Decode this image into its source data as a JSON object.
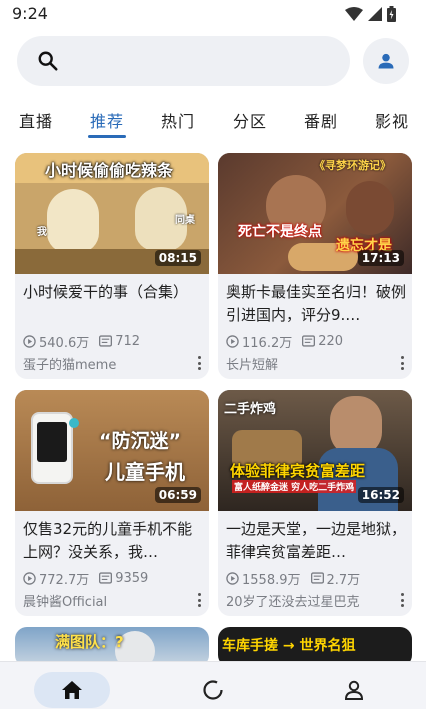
{
  "status_bar": {
    "time": "9:24"
  },
  "search": {
    "placeholder": ""
  },
  "tabs": [
    {
      "label": "直播",
      "active": false
    },
    {
      "label": "推荐",
      "active": true
    },
    {
      "label": "热门",
      "active": false
    },
    {
      "label": "分区",
      "active": false
    },
    {
      "label": "番剧",
      "active": false
    },
    {
      "label": "影视",
      "active": false
    }
  ],
  "videos": [
    {
      "thumb_text": "小时候偷偷吃辣条",
      "thumb_text_2": "我",
      "thumb_text_3": "同桌",
      "duration": "08:15",
      "title": "小时候爱干的事（合集）",
      "views": "540.6万",
      "danmaku": "712",
      "author": "蛋子的猫meme"
    },
    {
      "thumb_text": "《寻梦环游记》",
      "thumb_text_2": "死亡不是终点",
      "thumb_text_3": "遗忘才是",
      "duration": "17:13",
      "title": "奥斯卡最佳实至名归！破例引进国内，评分9.…",
      "views": "116.2万",
      "danmaku": "220",
      "author": "长片短解"
    },
    {
      "thumb_text": "“防沉迷”",
      "thumb_text_2": "儿童手机",
      "duration": "06:59",
      "title": "仅售32元的儿童手机不能上网？没关系，我…",
      "views": "772.7万",
      "danmaku": "9359",
      "author": "晨钟酱Official"
    },
    {
      "thumb_text": "二手炸鸡",
      "thumb_text_2": "体验菲律宾贫富差距",
      "thumb_text_3": "富人纸醉金迷 穷人吃二手炸鸡",
      "duration": "16:52",
      "title": "一边是天堂，一边是地狱，菲律宾贫富差距…",
      "views": "1558.9万",
      "danmaku": "2.7万",
      "author": "20岁了还没去过星巴克"
    },
    {
      "thumb_text": "满图队：?"
    },
    {
      "thumb_text": "车库手搓 → 世界名狙"
    }
  ],
  "colors": {
    "accent": "#2a6bb8",
    "card_bg": "#f0f1f5",
    "nav_active_bg": "#dce6f4"
  },
  "icons": {
    "search": "search-icon",
    "account": "person-icon",
    "home": "home-icon",
    "dynamic": "loading-ring-icon",
    "mine": "person-outline-icon"
  }
}
